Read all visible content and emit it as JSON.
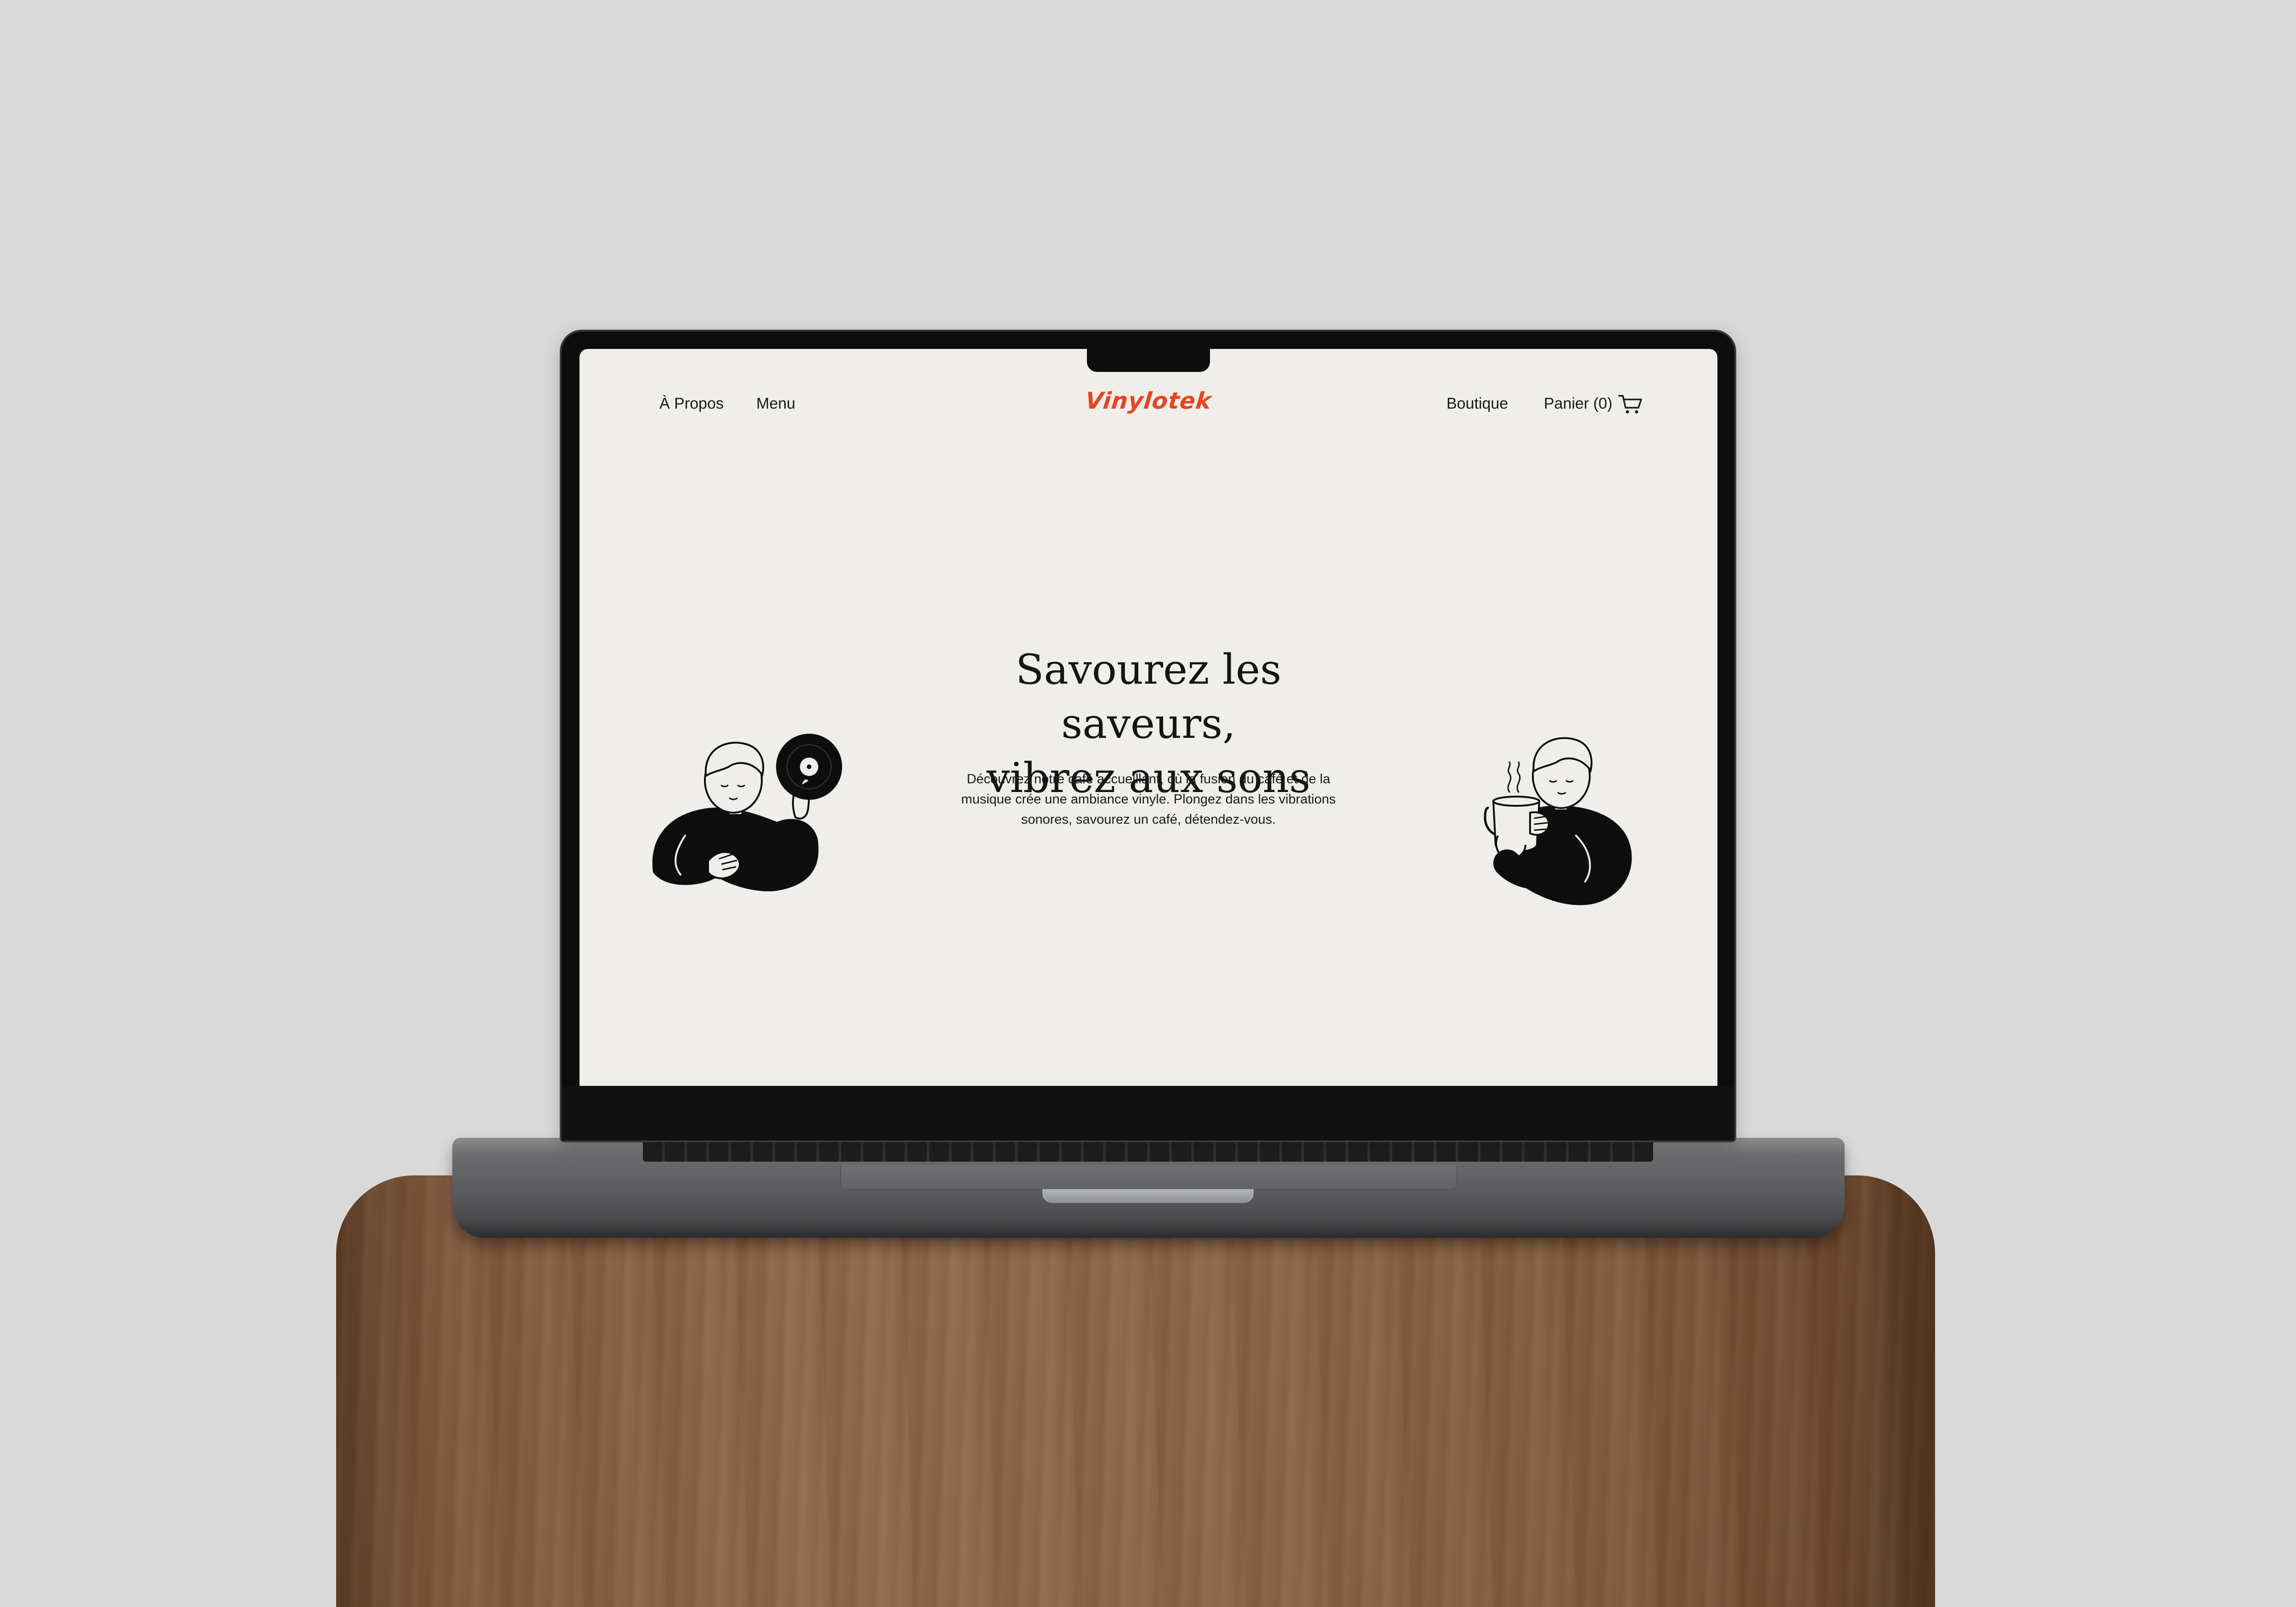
{
  "site": {
    "logo": "Vinylotek",
    "accent_color": "#e5461f",
    "background_color": "#efeeea"
  },
  "nav": {
    "left": [
      {
        "label": "À Propos"
      },
      {
        "label": "Menu"
      }
    ],
    "right": {
      "boutique_label": "Boutique",
      "cart_label": "Panier (0)",
      "cart_icon": "shopping-cart-icon"
    }
  },
  "hero": {
    "title_line1": "Savourez les saveurs,",
    "title_line2": "vibrez aux sons",
    "description": "Découvrez notre café accueillant, où la fusion du café et de la musique crée une ambiance vinyle. Plongez dans les vibrations sonores, savourez un café, détendez-vous."
  },
  "illustrations": {
    "left": "person-holding-vinyl-record-illustration",
    "right": "person-holding-coffee-mug-illustration"
  }
}
